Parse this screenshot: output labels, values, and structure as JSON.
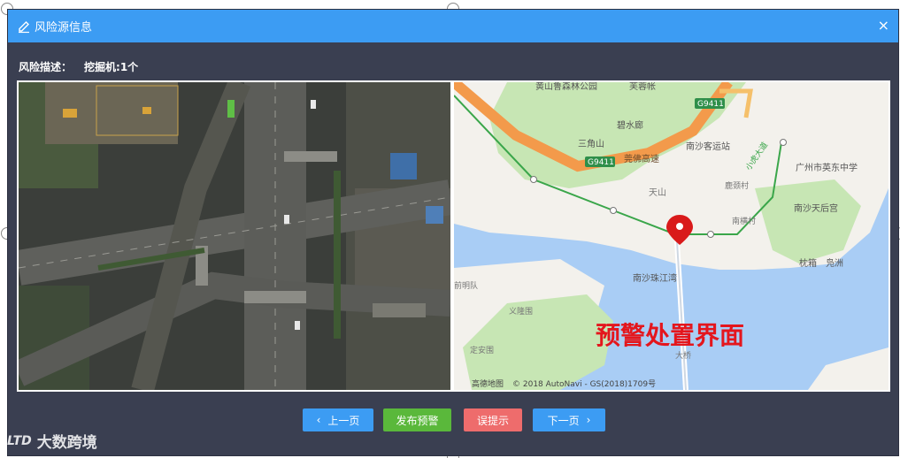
{
  "dialog": {
    "title": "风险源信息",
    "close_icon": "×"
  },
  "risk": {
    "label": "风险描述：",
    "value": "挖掘机:1个"
  },
  "map": {
    "labels": {
      "park": "黄山鲁森林公园",
      "hotel": "芙蓉帐",
      "g9411_top": "G9411",
      "bishuilang": "碧水廊",
      "sanjiaoshan": "三角山",
      "g9411_left": "G9411",
      "guanfo": "莞佛高速",
      "nansha_station": "南沙客运站",
      "xiaohu": "小虎大道",
      "school": "广州市英东中学",
      "tianshan": "天山",
      "lujingcun": "鹿颈村",
      "nanshatianhou": "南沙天后宫",
      "nanhengcun": "南横村",
      "zhenxiang": "枕箱",
      "fuzhou": "凫洲",
      "zhujiangwan": "南沙珠江湾",
      "qianmingdui": "前明队",
      "yilongwei": "义隆围",
      "dingan": "定安围",
      "bridge": "大桥",
      "watermark_red": "预警处置界面",
      "copyright": "© 2018 AutoNavi - GS(2018)1709号",
      "logo": "高德地图"
    }
  },
  "buttons": {
    "prev": "上一页",
    "publish": "发布预警",
    "false_alarm": "误提示",
    "next": "下一页"
  },
  "watermark": {
    "logo": "LTD",
    "text": "大数跨境"
  },
  "colors": {
    "title_bar": "#3c9cf3",
    "dialog_bg": "#3a3f51",
    "publish": "#5ab83b",
    "false_alarm": "#ee6c6c",
    "highway": "#f39a4b",
    "water": "#a9cdf5",
    "land": "#f3f1ec",
    "green": "#c7e6b4",
    "pin": "#d91a1a"
  }
}
